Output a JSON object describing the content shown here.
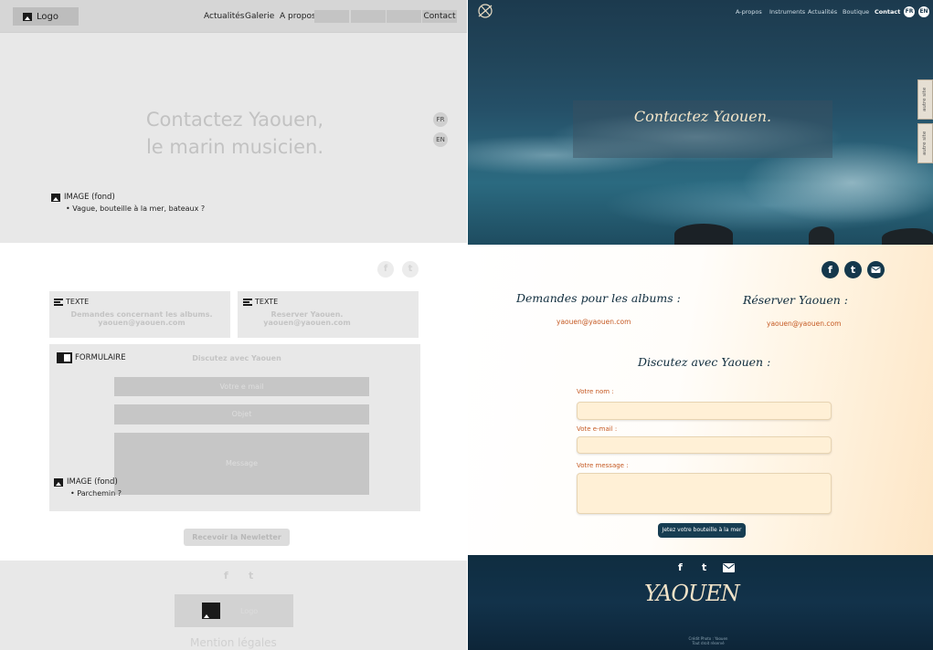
{
  "wireframe": {
    "nav": {
      "logo_label": "Logo",
      "items": [
        "Actualités",
        "Galerie",
        "A propos"
      ],
      "contact_label": "Contact"
    },
    "hero": {
      "title_line1": "Contactez Yaouen,",
      "title_line2": "le marin musicien.",
      "lang_fr": "FR",
      "lang_en": "EN",
      "image_annotation": "IMAGE (fond)",
      "image_note": "Vague, bouteille à la mer, bateaux ?"
    },
    "social": {
      "facebook": "f",
      "twitter": "t"
    },
    "text_box_1": {
      "label": "TEXTE",
      "line1": "Demandes concernant les albums.",
      "line2": "yaouen@yaouen.com"
    },
    "text_box_2": {
      "label": "TEXTE",
      "line1": "Reserver Yaouen.",
      "line2": "yaouen@yaouen.com"
    },
    "form": {
      "label": "FORMULAIRE",
      "title": "Discutez avec Yaouen",
      "email_placeholder": "Votre e mail",
      "subject_placeholder": "Objet",
      "message_placeholder": "Message",
      "image_annotation": "IMAGE (fond)",
      "image_note": "Parchemin ?"
    },
    "newsletter_label": "Recevoir la Newletter",
    "footer": {
      "facebook": "f",
      "twitter": "t",
      "logo_label": "Logo",
      "legal": "Mention légales"
    }
  },
  "design": {
    "nav": {
      "items": [
        "A-propos",
        "Instruments",
        "Actualités",
        "Boutique"
      ],
      "contact_label": "Contact",
      "lang_fr": "FR",
      "lang_en": "EN"
    },
    "hero_title": "Contactez Yaouen.",
    "side_tabs": [
      "autre site",
      "autre site"
    ],
    "social": {
      "facebook": "f",
      "twitter": "t"
    },
    "albums": {
      "title": "Demandes pour les albums :",
      "email": "yaouen@yaouen.com"
    },
    "booking": {
      "title": "Réserver Yaouen :",
      "email": "yaouen@yaouen.com"
    },
    "form": {
      "title": "Discutez avec Yaouen :",
      "name_label": "Votre nom :",
      "email_label": "Vote e-mail :",
      "message_label": "Votre message :",
      "submit_label": "Jetez votre bouteille à la mer"
    },
    "footer": {
      "facebook": "f",
      "twitter": "t",
      "logo_text": "YAOUEN",
      "credit_line1": "Crédit Photo : Yaouen",
      "credit_line2": "Tout droit réservé"
    }
  }
}
